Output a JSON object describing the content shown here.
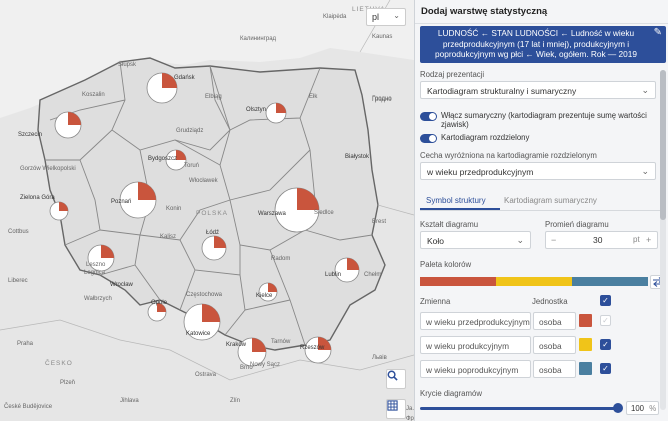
{
  "map": {
    "language": "pl",
    "countries": [
      "LIETUVA",
      "POLSKA",
      "ČESKO"
    ],
    "labels": [
      {
        "t": "Klaipėda",
        "c": "mid"
      },
      {
        "t": "Kaunas",
        "c": "mid"
      },
      {
        "t": "Калининград",
        "c": "mid"
      },
      {
        "t": "Słupsk",
        "c": "mid"
      },
      {
        "t": "Gdańsk",
        "c": "city"
      },
      {
        "t": "Olsztyn",
        "c": "city"
      },
      {
        "t": "Elbląg",
        "c": "mid"
      },
      {
        "t": "Koszalin",
        "c": "mid"
      },
      {
        "t": "Szczecin",
        "c": "city"
      },
      {
        "t": "Grudziądz",
        "c": "mid"
      },
      {
        "t": "Ełk",
        "c": "mid"
      },
      {
        "t": "Гродно",
        "c": "mid"
      },
      {
        "t": "Bydgoszcz",
        "c": "city"
      },
      {
        "t": "Toruń",
        "c": "mid"
      },
      {
        "t": "Białystok",
        "c": "city"
      },
      {
        "t": "Włocławek",
        "c": "mid"
      },
      {
        "t": "Gorzów Wielkopolski",
        "c": "mid"
      },
      {
        "t": "Poznań",
        "c": "city"
      },
      {
        "t": "Konin",
        "c": "mid"
      },
      {
        "t": "Warszawa",
        "c": "city"
      },
      {
        "t": "Siedlce",
        "c": "mid"
      },
      {
        "t": "Zielona Góra",
        "c": "city"
      },
      {
        "t": "Kalisz",
        "c": "mid"
      },
      {
        "t": "Łódź",
        "c": "city"
      },
      {
        "t": "Brest",
        "c": "mid"
      },
      {
        "t": "Cottbus",
        "c": "mid"
      },
      {
        "t": "Radom",
        "c": "mid"
      },
      {
        "t": "Leszno",
        "c": "mid"
      },
      {
        "t": "Legnica",
        "c": "mid"
      },
      {
        "t": "Wrocław",
        "c": "city"
      },
      {
        "t": "Lublin",
        "c": "city"
      },
      {
        "t": "Wałbrzych",
        "c": "mid"
      },
      {
        "t": "Chełm",
        "c": "mid"
      },
      {
        "t": "Kielce",
        "c": "city"
      },
      {
        "t": "Częstochowa",
        "c": "mid"
      },
      {
        "t": "Opole",
        "c": "city"
      },
      {
        "t": "Katowice",
        "c": "city"
      },
      {
        "t": "Kraków",
        "c": "city"
      },
      {
        "t": "Tarnów",
        "c": "mid"
      },
      {
        "t": "Rzeszów",
        "c": "city"
      },
      {
        "t": "Nowy Sącz",
        "c": "mid"
      },
      {
        "t": "Praha",
        "c": "mid"
      },
      {
        "t": "Liberec",
        "c": "mid"
      },
      {
        "t": "Ostrava",
        "c": "mid"
      },
      {
        "t": "Jihlava",
        "c": "mid"
      },
      {
        "t": "Zlín",
        "c": "mid"
      },
      {
        "t": "Brno",
        "c": "mid"
      },
      {
        "t": "Plzeň",
        "c": "mid"
      },
      {
        "t": "České Budějovice",
        "c": "mid"
      },
      {
        "t": "Львів",
        "c": "mid"
      },
      {
        "t": "Ja...",
        "c": "mid"
      },
      {
        "t": "Фра...",
        "c": "mid"
      },
      {
        "t": "Гродно",
        "c": "mid"
      }
    ],
    "pie_share": 0.25,
    "colors": {
      "land": "#e3e3e3",
      "region_border": "#777777",
      "pie_fill": "#ffffff",
      "pie_slice": "#c9553d"
    }
  },
  "panel": {
    "title": "Dodaj warstwę statystyczną",
    "breadcrumb": "LUDNOŚĆ ← STAN LUDNOŚCI ← Ludność w wieku przedprodukcyjnym (17 lat i mniej), produkcyjnym i poprodukcyjnym wg płci ← Wiek, ogółem. Rok — 2019",
    "presentation_label": "Rodzaj prezentacji",
    "presentation_value": "Kartodiagram strukturalny i sumaryczny",
    "toggle_sum": "Włącz sumaryczny (kartodiagram prezentuje sumę wartości zjawisk)",
    "toggle_split": "Kartodiagram rozdzielony",
    "feature_label": "Cecha wyróżniona na kartodiagramie rozdzielonym",
    "feature_value": "w wieku przedprodukcyjnym",
    "tab_symbol": "Symbol struktury",
    "tab_sum": "Kartodiagram sumaryczny",
    "shape_label": "Kształt diagramu",
    "shape_value": "Koło",
    "radius_label": "Promień diagramu",
    "radius_value": "30",
    "radius_unit": "pt",
    "palette_label": "Paleta kolorów",
    "palette": [
      "#c9553d",
      "#f0c419",
      "#4a7fa0"
    ],
    "col_variable": "Zmienna",
    "col_unit": "Jednostka",
    "variables": [
      {
        "name": "w wieku przedprodukcyjnym",
        "unit": "osoba",
        "color": "#c9553d",
        "checked": false
      },
      {
        "name": "w wieku produkcyjnym",
        "unit": "osoba",
        "color": "#f0c419",
        "checked": true
      },
      {
        "name": "w wieku poprodukcyjnym",
        "unit": "osoba",
        "color": "#4a7fa0",
        "checked": true
      }
    ],
    "opacity_label": "Krycie diagramów",
    "opacity_value": "100",
    "opacity_unit": "%",
    "accent": "#2d4f9a"
  }
}
